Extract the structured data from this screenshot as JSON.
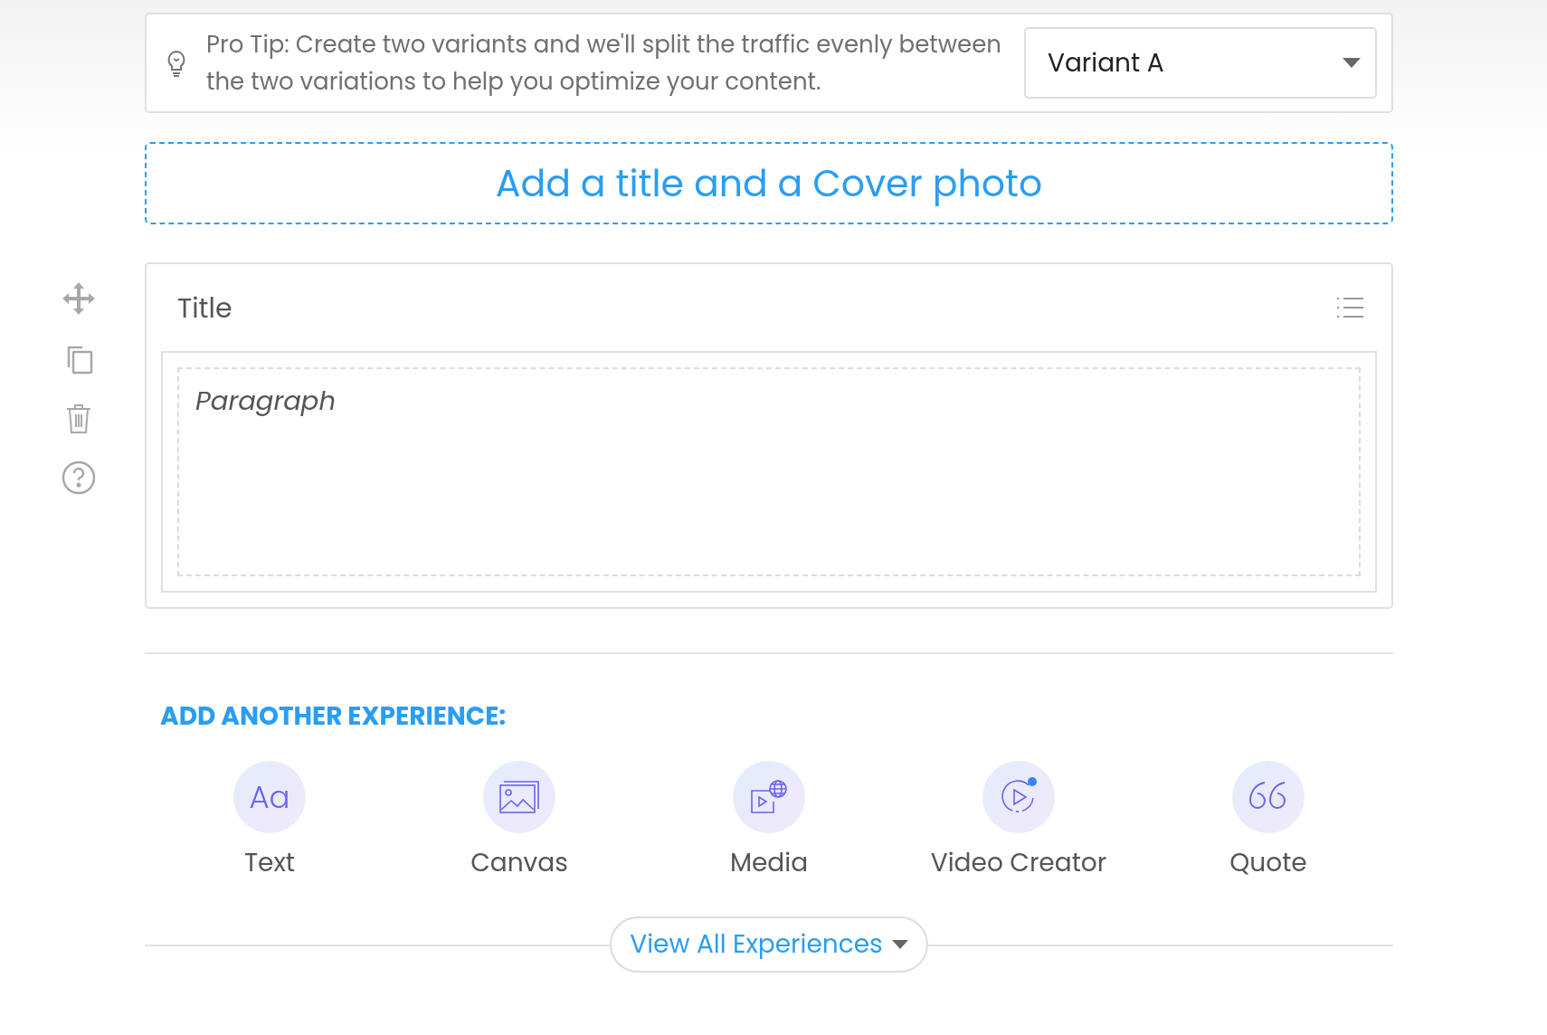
{
  "tip": {
    "text": "Pro Tip: Create two variants and we'll split the traffic evenly between the two variations to help you optimize your content.",
    "variant_select": {
      "value": "Variant A"
    }
  },
  "cover_prompt": "Add a title and a Cover photo",
  "block_tools": [
    {
      "kind": "move"
    },
    {
      "kind": "duplicate"
    },
    {
      "kind": "delete"
    },
    {
      "kind": "help"
    }
  ],
  "editor": {
    "title": "Title",
    "paragraph_placeholder": "Paragraph"
  },
  "experiences": {
    "heading": "ADD ANOTHER EXPERIENCE:",
    "items": [
      {
        "kind": "text",
        "label": "Text",
        "icon_text": "Aa"
      },
      {
        "kind": "canvas",
        "label": "Canvas"
      },
      {
        "kind": "media",
        "label": "Media"
      },
      {
        "kind": "video",
        "label": "Video Creator"
      },
      {
        "kind": "quote",
        "label": "Quote"
      }
    ],
    "view_all": "View All Experiences"
  }
}
